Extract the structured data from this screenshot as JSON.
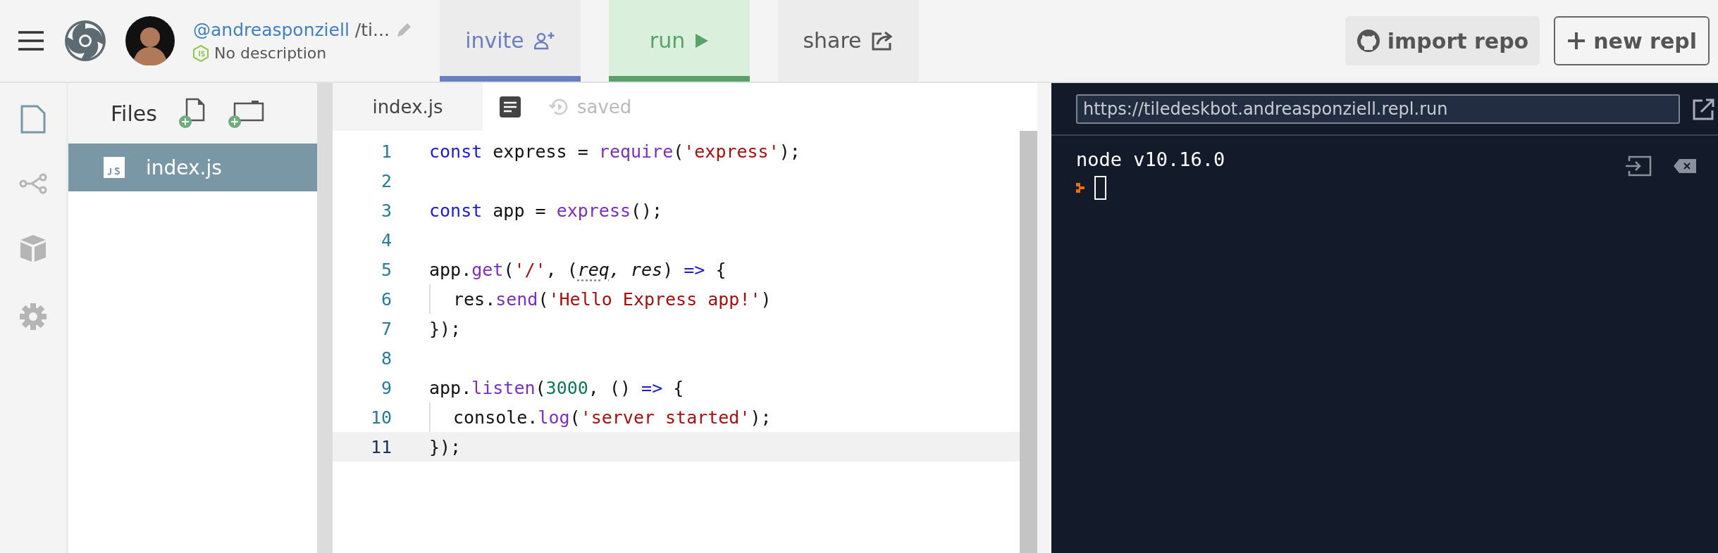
{
  "header": {
    "user": "@andreasponziell",
    "repl_name": "/ti...",
    "description": "No description",
    "tabs": [
      {
        "label": "invite",
        "kind": "invite"
      },
      {
        "label": "run",
        "kind": "run"
      },
      {
        "label": "share",
        "kind": "share"
      }
    ],
    "actions": [
      {
        "label": "import repo",
        "kind": "import"
      },
      {
        "label": "new repl",
        "kind": "new"
      }
    ]
  },
  "sidebar": {
    "items": [
      {
        "kind": "files",
        "selected": true
      },
      {
        "kind": "share",
        "selected": false
      },
      {
        "kind": "packages",
        "selected": false
      },
      {
        "kind": "settings",
        "selected": false
      }
    ]
  },
  "files": {
    "title": "Files",
    "items": [
      {
        "name": "index.js",
        "selected": true
      }
    ]
  },
  "editor": {
    "tab": "index.js",
    "status": "saved",
    "lines": [
      {
        "number": "1",
        "active": false,
        "tokens": [
          {
            "kind": "keyword",
            "text": "const"
          },
          {
            "kind": "plain",
            "text": " express = "
          },
          {
            "kind": "func",
            "text": "require"
          },
          {
            "kind": "plain",
            "text": "("
          },
          {
            "kind": "string",
            "text": "'express'"
          },
          {
            "kind": "plain",
            "text": ");"
          }
        ]
      },
      {
        "number": "2",
        "active": false
      },
      {
        "number": "3",
        "active": false,
        "tokens": [
          {
            "kind": "keyword",
            "text": "const"
          },
          {
            "kind": "plain",
            "text": " app = "
          },
          {
            "kind": "func",
            "text": "express"
          },
          {
            "kind": "plain",
            "text": "();"
          }
        ]
      },
      {
        "number": "4",
        "active": false
      },
      {
        "number": "5",
        "active": false,
        "tokens": [
          {
            "kind": "plain",
            "text": "app."
          },
          {
            "kind": "func",
            "text": "get"
          },
          {
            "kind": "plain",
            "text": "("
          },
          {
            "kind": "string",
            "text": "'/'"
          },
          {
            "kind": "plain",
            "text": ", ("
          },
          {
            "kind": "hint",
            "text": "req"
          },
          {
            "kind": "italic",
            "text": ", res"
          },
          {
            "kind": "plain",
            "text": ") "
          },
          {
            "kind": "keyword",
            "text": "=>"
          },
          {
            "kind": "plain",
            "text": " {"
          }
        ]
      },
      {
        "number": "6",
        "active": false,
        "indented": true,
        "tokens": [
          {
            "kind": "plain",
            "text": "res."
          },
          {
            "kind": "func",
            "text": "send"
          },
          {
            "kind": "plain",
            "text": "("
          },
          {
            "kind": "string",
            "text": "'Hello Express app!'"
          },
          {
            "kind": "plain",
            "text": ")"
          }
        ]
      },
      {
        "number": "7",
        "active": false,
        "tokens": [
          {
            "kind": "plain",
            "text": "});"
          }
        ]
      },
      {
        "number": "8",
        "active": false
      },
      {
        "number": "9",
        "active": false,
        "tokens": [
          {
            "kind": "plain",
            "text": "app."
          },
          {
            "kind": "func",
            "text": "listen"
          },
          {
            "kind": "plain",
            "text": "("
          },
          {
            "kind": "number",
            "text": "3000"
          },
          {
            "kind": "plain",
            "text": ", () "
          },
          {
            "kind": "keyword",
            "text": "=>"
          },
          {
            "kind": "plain",
            "text": " {"
          }
        ]
      },
      {
        "number": "10",
        "active": false,
        "indented": true,
        "tokens": [
          {
            "kind": "plain",
            "text": "console."
          },
          {
            "kind": "func",
            "text": "log"
          },
          {
            "kind": "plain",
            "text": "("
          },
          {
            "kind": "string",
            "text": "'server started'"
          },
          {
            "kind": "plain",
            "text": ");"
          }
        ]
      },
      {
        "number": "11",
        "active": true,
        "tokens": [
          {
            "kind": "plain",
            "text": "});"
          }
        ]
      }
    ]
  },
  "console": {
    "url": "https://tiledeskbot.andreasponziell.repl.run",
    "output": [
      "node v10.16.0"
    ]
  }
}
